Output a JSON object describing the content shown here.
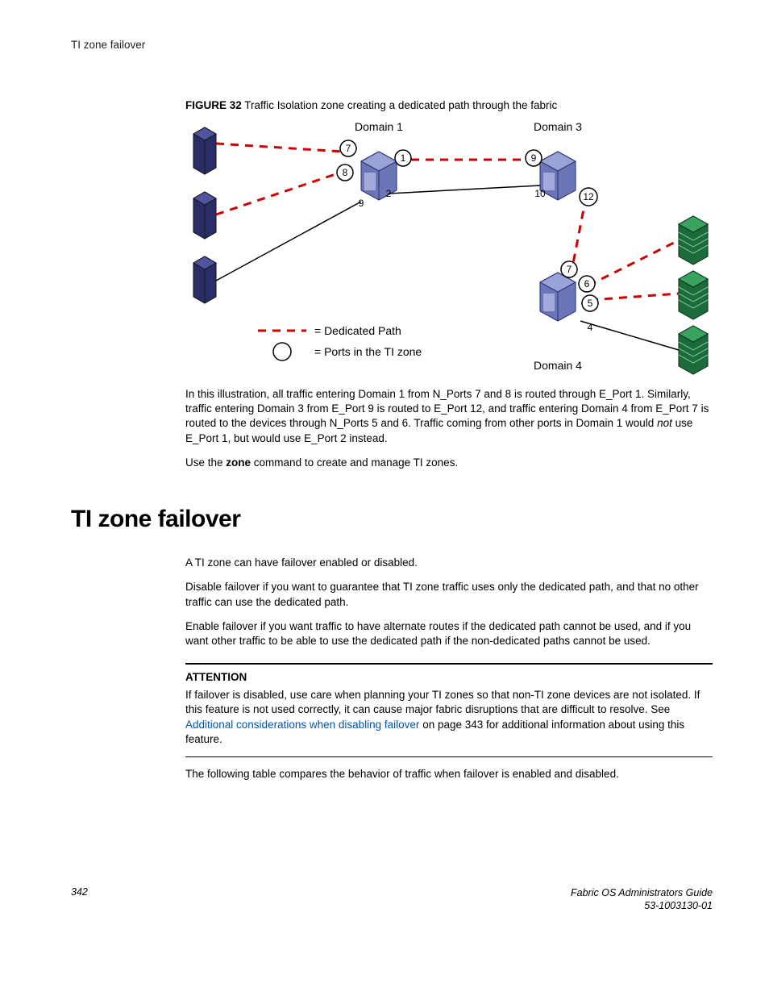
{
  "running_head": "TI zone failover",
  "figure": {
    "label": "FIGURE 32",
    "caption": "Traffic Isolation zone creating a dedicated path through the fabric",
    "domain1": "Domain 1",
    "domain3": "Domain 3",
    "domain4": "Domain 4",
    "legend_dedicated": "= Dedicated Path",
    "legend_ports": "= Ports in the TI zone",
    "ports": {
      "p1": "1",
      "p2": "2",
      "p5": "5",
      "p6": "6",
      "p7a": "7",
      "p7b": "7",
      "p8": "8",
      "p9a": "9",
      "p9b": "9",
      "p10": "10",
      "p12": "12",
      "p4": "4"
    }
  },
  "body": {
    "p1a": "In this illustration, all traffic entering Domain 1 from N_Ports 7 and 8 is routed through E_Port 1. Similarly, traffic entering Domain 3 from E_Port 9 is routed to E_Port 12, and traffic entering Domain 4 from E_Port 7 is routed to the devices through N_Ports 5 and 6. Traffic coming from other ports in Domain 1 would ",
    "p1_not": "not",
    "p1b": " use E_Port 1, but would use E_Port 2 instead.",
    "p2a": "Use the ",
    "p2_zone": "zone",
    "p2b": " command to create and manage TI zones."
  },
  "section_heading": "TI zone failover",
  "failover": {
    "p1": "A TI zone can have failover enabled or disabled.",
    "p2": "Disable failover if you want to guarantee that TI zone traffic uses only the dedicated path, and that no other traffic can use the dedicated path.",
    "p3": "Enable failover if you want traffic to have alternate routes if the dedicated path cannot be used, and if you want other traffic to be able to use the dedicated path if the non-dedicated paths cannot be used."
  },
  "attention": {
    "label": "ATTENTION",
    "text_a": "If failover is disabled, use care when planning your TI zones so that non-TI zone devices are not isolated. If this feature is not used correctly, it can cause major fabric disruptions that are difficult to resolve. See ",
    "link": "Additional considerations when disabling failover",
    "text_b": " on page 343 for additional information about using this feature."
  },
  "after_attention": "The following table compares the behavior of traffic when failover is enabled and disabled.",
  "footer": {
    "page_num": "342",
    "doc_title": "Fabric OS Administrators Guide",
    "doc_num": "53-1003130-01"
  }
}
